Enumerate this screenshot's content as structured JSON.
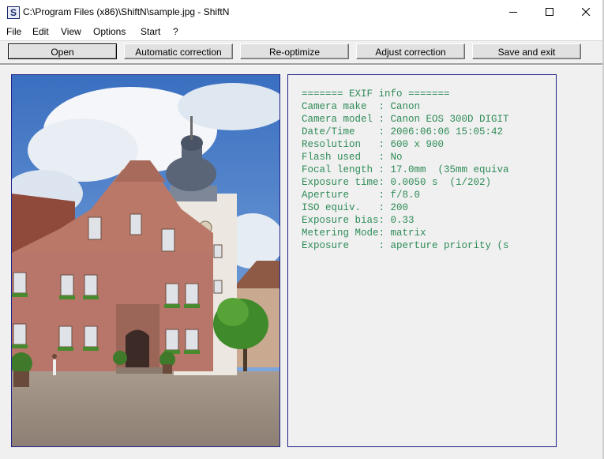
{
  "window": {
    "title": "C:\\Program Files (x86)\\ShiftN\\sample.jpg - ShiftN",
    "app_icon_letter": "S",
    "controls": [
      "minimize-icon",
      "maximize-icon",
      "close-icon"
    ]
  },
  "menu": {
    "items": [
      "File",
      "Edit",
      "View",
      "Options",
      "Start",
      "?"
    ]
  },
  "toolbar": {
    "buttons": [
      "Open",
      "Automatic correction",
      "Re-optimize",
      "Adjust correction",
      "Save and exit"
    ]
  },
  "image": {
    "description_icon": "photo-town-hall"
  },
  "exif": {
    "header": "======= EXIF info =======",
    "lines": [
      "Camera make  : Canon",
      "Camera model : Canon EOS 300D DIGIT",
      "Date/Time    : 2006:06:06 15:05:42",
      "Resolution   : 600 x 900",
      "Flash used   : No",
      "Focal length : 17.0mm  (35mm equiva",
      "Exposure time: 0.0050 s  (1/202)",
      "Aperture     : f/8.0",
      "ISO equiv.   : 200",
      "Exposure bias: 0.33",
      "Metering Mode: matrix",
      "Exposure     : aperture priority (s"
    ]
  },
  "colors": {
    "exif_text": "#2e8b57",
    "panel_border": "#20208a",
    "background": "#f0f0f0"
  }
}
